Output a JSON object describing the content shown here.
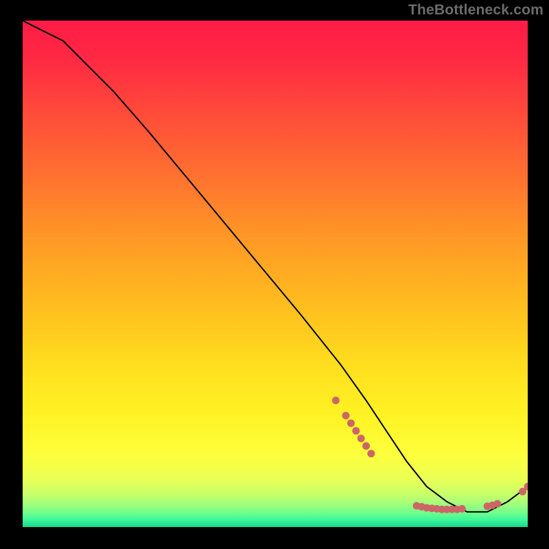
{
  "watermark": "TheBottleneck.com",
  "chart_data": {
    "type": "line",
    "title": "",
    "xlabel": "",
    "ylabel": "",
    "xlim": [
      0,
      100
    ],
    "ylim": [
      0,
      100
    ],
    "series": [
      {
        "name": "curve",
        "x": [
          0,
          4,
          8,
          12,
          18,
          25,
          35,
          45,
          55,
          63,
          68,
          72,
          76,
          80,
          84,
          88,
          92,
          96,
          100
        ],
        "y": [
          100,
          98,
          96,
          92,
          86,
          78,
          66,
          54,
          42,
          32,
          25,
          19,
          13,
          8,
          5,
          3,
          3,
          5,
          8
        ]
      }
    ],
    "markers": [
      {
        "x": 62,
        "y": 25
      },
      {
        "x": 64,
        "y": 22
      },
      {
        "x": 65,
        "y": 20.5
      },
      {
        "x": 66,
        "y": 19
      },
      {
        "x": 67,
        "y": 17.5
      },
      {
        "x": 68,
        "y": 16
      },
      {
        "x": 69,
        "y": 14.5
      },
      {
        "x": 78,
        "y": 4.2
      },
      {
        "x": 79,
        "y": 4.0
      },
      {
        "x": 80,
        "y": 3.8
      },
      {
        "x": 81,
        "y": 3.7
      },
      {
        "x": 82,
        "y": 3.6
      },
      {
        "x": 83,
        "y": 3.5
      },
      {
        "x": 84,
        "y": 3.5
      },
      {
        "x": 85,
        "y": 3.5
      },
      {
        "x": 86,
        "y": 3.5
      },
      {
        "x": 87,
        "y": 3.6
      },
      {
        "x": 92,
        "y": 4.1
      },
      {
        "x": 93,
        "y": 4.3
      },
      {
        "x": 94,
        "y": 4.6
      },
      {
        "x": 99,
        "y": 7.0
      },
      {
        "x": 100,
        "y": 8.0
      }
    ],
    "gradient_stops": [
      {
        "pos": 0.0,
        "color": "#ff1b46"
      },
      {
        "pos": 0.08,
        "color": "#ff2a43"
      },
      {
        "pos": 0.18,
        "color": "#ff4a3a"
      },
      {
        "pos": 0.3,
        "color": "#ff6f30"
      },
      {
        "pos": 0.42,
        "color": "#ff9526"
      },
      {
        "pos": 0.55,
        "color": "#ffba1f"
      },
      {
        "pos": 0.68,
        "color": "#ffde1e"
      },
      {
        "pos": 0.78,
        "color": "#fff324"
      },
      {
        "pos": 0.86,
        "color": "#fdff3d"
      },
      {
        "pos": 0.905,
        "color": "#eaff55"
      },
      {
        "pos": 0.935,
        "color": "#c8ff6a"
      },
      {
        "pos": 0.955,
        "color": "#a0ff7c"
      },
      {
        "pos": 0.972,
        "color": "#70ff8c"
      },
      {
        "pos": 0.986,
        "color": "#3cf79a"
      },
      {
        "pos": 1.0,
        "color": "#14d98f"
      }
    ],
    "curve_color": "#000000",
    "marker_color": "#cc6666"
  }
}
